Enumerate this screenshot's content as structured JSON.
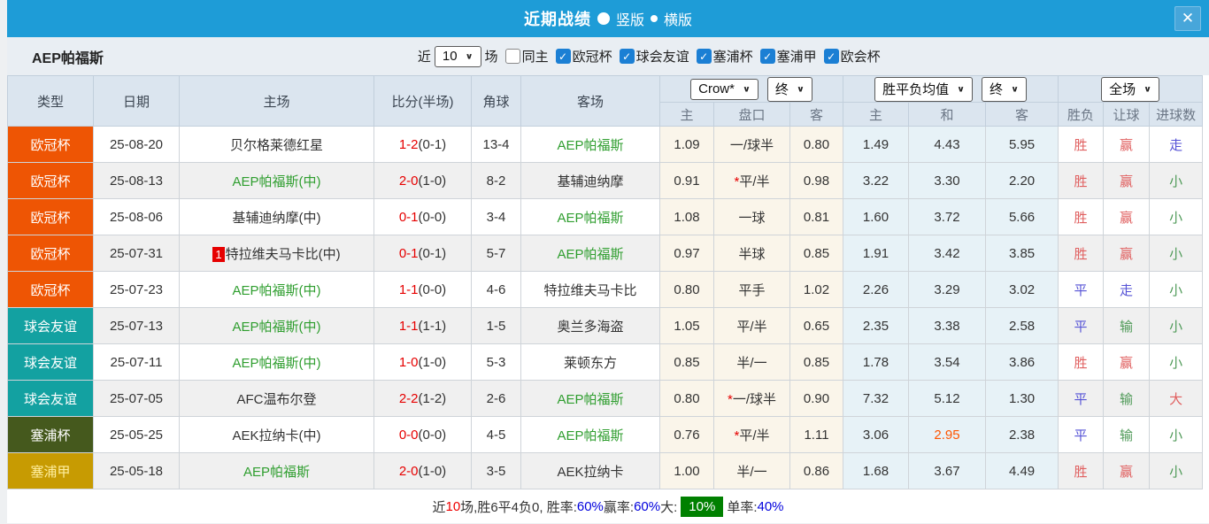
{
  "icons": {
    "close": "✕",
    "check": "✓",
    "chevron": "∨"
  },
  "titlebar": {
    "title": "近期战绩",
    "radio_vertical_label": "竖版",
    "radio_horizontal_label": "横版",
    "selected_layout": "竖版"
  },
  "filter": {
    "team": "AEP帕福斯",
    "near_label": "近",
    "match_count": "10",
    "games_label": "场",
    "same_venue_label": "同主",
    "leagues": [
      "欧冠杯",
      "球会友谊",
      "塞浦杯",
      "塞浦甲",
      "欧会杯"
    ]
  },
  "table": {
    "col_headers": [
      "类型",
      "日期",
      "主场",
      "比分(半场)",
      "角球",
      "客场"
    ],
    "selects": {
      "odds_source": "Crow*",
      "odds_time_1": "终",
      "avg_source": "胜平负均值",
      "odds_time_2": "终",
      "scope": "全场"
    },
    "sub_headers": [
      "主",
      "盘口",
      "客",
      "主",
      "和",
      "客",
      "胜负",
      "让球",
      "进球数"
    ],
    "rows": [
      {
        "type": "欧冠杯",
        "date": "25-08-20",
        "home": "贝尔格莱德红星",
        "home_green": false,
        "home_badge": "",
        "score": "1-2",
        "half": "(0-1)",
        "corner": "13-4",
        "away": "AEP帕福斯",
        "away_green": true,
        "odds": [
          "1.09",
          "一/球半",
          "0.80"
        ],
        "avg": [
          "1.49",
          "4.43",
          "5.95"
        ],
        "avg_hot": -1,
        "results": [
          "胜",
          "赢",
          "走"
        ]
      },
      {
        "type": "欧冠杯",
        "date": "25-08-13",
        "home": "AEP帕福斯(中)",
        "home_green": true,
        "home_badge": "",
        "score": "2-0",
        "half": "(1-0)",
        "corner": "8-2",
        "away": "基辅迪纳摩",
        "away_green": false,
        "odds": [
          "0.91",
          "*平/半",
          "0.98"
        ],
        "avg": [
          "3.22",
          "3.30",
          "2.20"
        ],
        "avg_hot": -1,
        "results": [
          "胜",
          "赢",
          "小"
        ]
      },
      {
        "type": "欧冠杯",
        "date": "25-08-06",
        "home": "基辅迪纳摩(中)",
        "home_green": false,
        "home_badge": "",
        "score": "0-1",
        "half": "(0-0)",
        "corner": "3-4",
        "away": "AEP帕福斯",
        "away_green": true,
        "odds": [
          "1.08",
          "一球",
          "0.81"
        ],
        "avg": [
          "1.60",
          "3.72",
          "5.66"
        ],
        "avg_hot": -1,
        "results": [
          "胜",
          "赢",
          "小"
        ]
      },
      {
        "type": "欧冠杯",
        "date": "25-07-31",
        "home": "特拉维夫马卡比(中)",
        "home_green": false,
        "home_badge": "1",
        "score": "0-1",
        "half": "(0-1)",
        "corner": "5-7",
        "away": "AEP帕福斯",
        "away_green": true,
        "odds": [
          "0.97",
          "半球",
          "0.85"
        ],
        "avg": [
          "1.91",
          "3.42",
          "3.85"
        ],
        "avg_hot": -1,
        "results": [
          "胜",
          "赢",
          "小"
        ]
      },
      {
        "type": "欧冠杯",
        "date": "25-07-23",
        "home": "AEP帕福斯(中)",
        "home_green": true,
        "home_badge": "",
        "score": "1-1",
        "half": "(0-0)",
        "corner": "4-6",
        "away": "特拉维夫马卡比",
        "away_green": false,
        "odds": [
          "0.80",
          "平手",
          "1.02"
        ],
        "avg": [
          "2.26",
          "3.29",
          "3.02"
        ],
        "avg_hot": -1,
        "results": [
          "平",
          "走",
          "小"
        ]
      },
      {
        "type": "球会友谊",
        "date": "25-07-13",
        "home": "AEP帕福斯(中)",
        "home_green": true,
        "home_badge": "",
        "score": "1-1",
        "half": "(1-1)",
        "corner": "1-5",
        "away": "奥兰多海盗",
        "away_green": false,
        "odds": [
          "1.05",
          "平/半",
          "0.65"
        ],
        "avg": [
          "2.35",
          "3.38",
          "2.58"
        ],
        "avg_hot": -1,
        "results": [
          "平",
          "输",
          "小"
        ]
      },
      {
        "type": "球会友谊",
        "date": "25-07-11",
        "home": "AEP帕福斯(中)",
        "home_green": true,
        "home_badge": "",
        "score": "1-0",
        "half": "(1-0)",
        "corner": "5-3",
        "away": "莱顿东方",
        "away_green": false,
        "odds": [
          "0.85",
          "半/一",
          "0.85"
        ],
        "avg": [
          "1.78",
          "3.54",
          "3.86"
        ],
        "avg_hot": -1,
        "results": [
          "胜",
          "赢",
          "小"
        ]
      },
      {
        "type": "球会友谊",
        "date": "25-07-05",
        "home": "AFC温布尔登",
        "home_green": false,
        "home_badge": "",
        "score": "2-2",
        "half": "(1-2)",
        "corner": "2-6",
        "away": "AEP帕福斯",
        "away_green": true,
        "odds": [
          "0.80",
          "*一/球半",
          "0.90"
        ],
        "avg": [
          "7.32",
          "5.12",
          "1.30"
        ],
        "avg_hot": -1,
        "results": [
          "平",
          "输",
          "大"
        ]
      },
      {
        "type": "塞浦杯",
        "date": "25-05-25",
        "home": "AEK拉纳卡(中)",
        "home_green": false,
        "home_badge": "",
        "score": "0-0",
        "half": "(0-0)",
        "corner": "4-5",
        "away": "AEP帕福斯",
        "away_green": true,
        "odds": [
          "0.76",
          "*平/半",
          "1.11"
        ],
        "avg": [
          "3.06",
          "2.95",
          "2.38"
        ],
        "avg_hot": 1,
        "results": [
          "平",
          "输",
          "小"
        ]
      },
      {
        "type": "塞浦甲",
        "date": "25-05-18",
        "home": "AEP帕福斯",
        "home_green": true,
        "home_badge": "",
        "score": "2-0",
        "half": "(1-0)",
        "corner": "3-5",
        "away": "AEK拉纳卡",
        "away_green": false,
        "odds": [
          "1.00",
          "半/一",
          "0.86"
        ],
        "avg": [
          "1.68",
          "3.67",
          "4.49"
        ],
        "avg_hot": -1,
        "results": [
          "胜",
          "赢",
          "小"
        ]
      }
    ]
  },
  "league_colors": {
    "欧冠杯": {
      "bg": "#ee5504",
      "fg": "#ffffff"
    },
    "球会友谊": {
      "bg": "#13a1a1",
      "fg": "#ffffff"
    },
    "塞浦杯": {
      "bg": "#45591d",
      "fg": "#ffffff"
    },
    "塞浦甲": {
      "bg": "#c79b02",
      "fg": "#ffefa0"
    }
  },
  "result_colors": {
    "胜": "#e05f5f",
    "平": "#5653d6",
    "赢": "#e05f5f",
    "走": "#5653d6",
    "输": "#4f9a58",
    "小": "#4f9a58",
    "大": "#e05f5f"
  },
  "summary": {
    "segments": [
      {
        "text": "近",
        "style": "plain"
      },
      {
        "text": "10",
        "style": "red"
      },
      {
        "text": "场,胜6平4负0, 胜率:",
        "style": "plain"
      },
      {
        "text": "60%",
        "style": "blue"
      },
      {
        "text": " 赢率:",
        "style": "plain"
      },
      {
        "text": "60%",
        "style": "blue"
      },
      {
        "text": " 大:",
        "style": "plain"
      },
      {
        "text": "10%",
        "style": "badge"
      },
      {
        "text": " 单率:",
        "style": "plain"
      },
      {
        "text": "40%",
        "style": "blue"
      }
    ]
  }
}
